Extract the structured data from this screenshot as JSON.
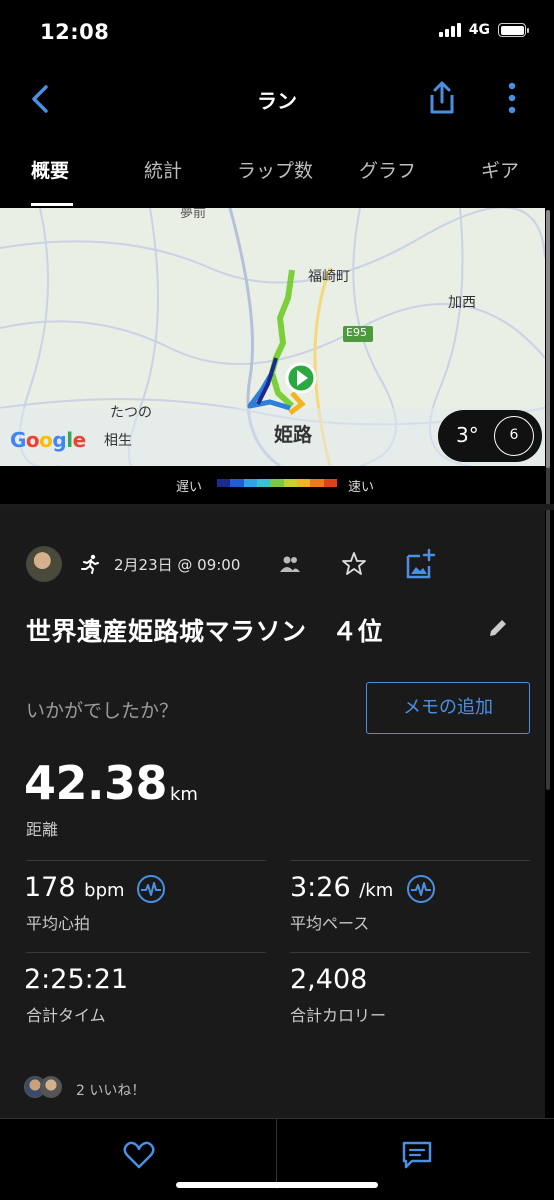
{
  "status_bar": {
    "time": "12:08",
    "network": "4G"
  },
  "nav": {
    "title": "ラン"
  },
  "tabs": [
    {
      "label": "概要"
    },
    {
      "label": "統計"
    },
    {
      "label": "ラップ数"
    },
    {
      "label": "グラフ"
    },
    {
      "label": "ギア"
    }
  ],
  "map": {
    "labels": {
      "fukusaki": "福崎町",
      "kasai": "加西",
      "e95": "E95",
      "tatsuno": "たつの",
      "aioi": "相生",
      "himeji": "姫路",
      "top_partial": "夢前"
    },
    "google": "Google",
    "weather": {
      "temp": "3°",
      "wind": "6"
    }
  },
  "legend": {
    "slow": "遅い",
    "fast": "速い",
    "colors": [
      "#1b2a8f",
      "#1f5fd6",
      "#2ea5e8",
      "#35c3d6",
      "#7cc843",
      "#c6d12b",
      "#f2b51f",
      "#f07a1a",
      "#e0401b"
    ]
  },
  "activity": {
    "date": "2月23日 @ 09:00",
    "title": "世界遺産姫路城マラソン　４位",
    "prompt": "いかがでしたか？",
    "memo_button": "メモの追加"
  },
  "stats": {
    "distance": {
      "value": "42.38",
      "unit": "km",
      "label": "距離"
    },
    "avg_hr": {
      "value": "178",
      "unit": "bpm",
      "label": "平均心拍"
    },
    "avg_pace": {
      "value": "3:26",
      "unit": "/km",
      "label": "平均ペース"
    },
    "total_time": {
      "value": "2:25:21",
      "label": "合計タイム"
    },
    "calories": {
      "value": "2,408",
      "label": "合計カロリー"
    }
  },
  "likes": {
    "text": "2 いいね！"
  }
}
